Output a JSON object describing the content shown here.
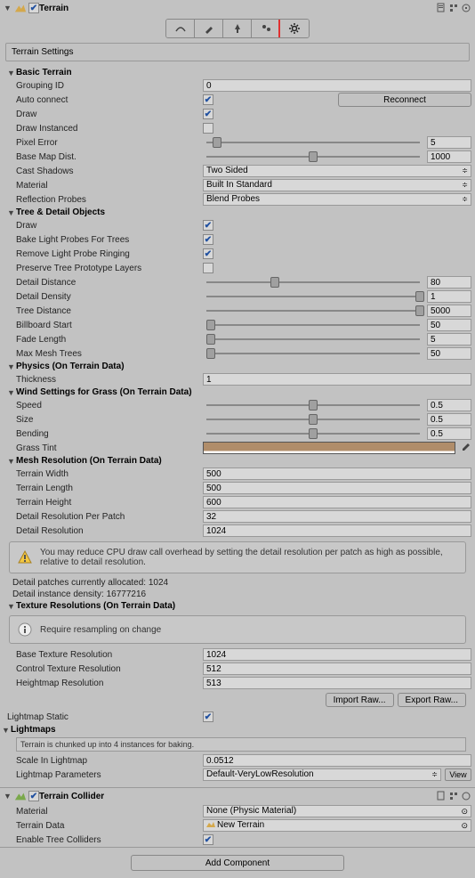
{
  "terrain": {
    "title": "Terrain",
    "settingsLabel": "Terrain Settings",
    "basicTerrain": {
      "header": "Basic Terrain",
      "groupingId": {
        "label": "Grouping ID",
        "value": "0"
      },
      "autoConnect": {
        "label": "Auto connect",
        "checked": true,
        "button": "Reconnect"
      },
      "draw": {
        "label": "Draw",
        "checked": true
      },
      "drawInstanced": {
        "label": "Draw Instanced",
        "checked": false
      },
      "pixelError": {
        "label": "Pixel Error",
        "value": "5",
        "pct": 5
      },
      "baseMapDist": {
        "label": "Base Map Dist.",
        "value": "1000",
        "pct": 50
      },
      "castShadows": {
        "label": "Cast Shadows",
        "value": "Two Sided"
      },
      "material": {
        "label": "Material",
        "value": "Built In Standard"
      },
      "reflectionProbes": {
        "label": "Reflection Probes",
        "value": "Blend Probes"
      }
    },
    "treeDetail": {
      "header": "Tree & Detail Objects",
      "draw": {
        "label": "Draw",
        "checked": true
      },
      "bakeLightProbes": {
        "label": "Bake Light Probes For Trees",
        "checked": true
      },
      "removeRinging": {
        "label": "Remove Light Probe Ringing",
        "checked": true
      },
      "preserveLayers": {
        "label": "Preserve Tree Prototype Layers",
        "checked": false
      },
      "detailDistance": {
        "label": "Detail Distance",
        "value": "80",
        "pct": 32
      },
      "detailDensity": {
        "label": "Detail Density",
        "value": "1",
        "pct": 100
      },
      "treeDistance": {
        "label": "Tree Distance",
        "value": "5000",
        "pct": 100
      },
      "billboardStart": {
        "label": "Billboard Start",
        "value": "50",
        "pct": 2
      },
      "fadeLength": {
        "label": "Fade Length",
        "value": "5",
        "pct": 2
      },
      "maxMeshTrees": {
        "label": "Max Mesh Trees",
        "value": "50",
        "pct": 2
      }
    },
    "physics": {
      "header": "Physics (On Terrain Data)",
      "thickness": {
        "label": "Thickness",
        "value": "1"
      }
    },
    "wind": {
      "header": "Wind Settings for Grass (On Terrain Data)",
      "speed": {
        "label": "Speed",
        "value": "0.5",
        "pct": 50
      },
      "size": {
        "label": "Size",
        "value": "0.5",
        "pct": 50
      },
      "bending": {
        "label": "Bending",
        "value": "0.5",
        "pct": 50
      },
      "grassTint": {
        "label": "Grass Tint",
        "color": "#b08d6a"
      }
    },
    "meshRes": {
      "header": "Mesh Resolution (On Terrain Data)",
      "terrainWidth": {
        "label": "Terrain Width",
        "value": "500"
      },
      "terrainLength": {
        "label": "Terrain Length",
        "value": "500"
      },
      "terrainHeight": {
        "label": "Terrain Height",
        "value": "600"
      },
      "detailResPerPatch": {
        "label": "Detail Resolution Per Patch",
        "value": "32"
      },
      "detailRes": {
        "label": "Detail Resolution",
        "value": "1024"
      },
      "warning": "You may reduce CPU draw call overhead by setting the detail resolution per patch as high as possible, relative to detail resolution.",
      "patches": "Detail patches currently allocated: 1024",
      "density": "Detail instance density: 16777216"
    },
    "texRes": {
      "header": "Texture Resolutions (On Terrain Data)",
      "info": "Require resampling on change",
      "baseTexture": {
        "label": "Base Texture Resolution",
        "value": "1024"
      },
      "controlTexture": {
        "label": "Control Texture Resolution",
        "value": "512"
      },
      "heightmap": {
        "label": "Heightmap Resolution",
        "value": "513"
      },
      "importBtn": "Import Raw...",
      "exportBtn": "Export Raw..."
    },
    "lightmapStatic": {
      "label": "Lightmap Static",
      "checked": true
    },
    "lightmaps": {
      "header": "Lightmaps",
      "info": "Terrain is chunked up into 4 instances for baking.",
      "scale": {
        "label": "Scale In Lightmap",
        "value": "0.0512"
      },
      "params": {
        "label": "Lightmap Parameters",
        "value": "Default-VeryLowResolution",
        "viewBtn": "View"
      }
    }
  },
  "collider": {
    "title": "Terrain Collider",
    "material": {
      "label": "Material",
      "value": "None (Physic Material)"
    },
    "terrainData": {
      "label": "Terrain Data",
      "value": "New Terrain"
    },
    "enableTreeColliders": {
      "label": "Enable Tree Colliders",
      "checked": true
    }
  },
  "addComponent": "Add Component"
}
